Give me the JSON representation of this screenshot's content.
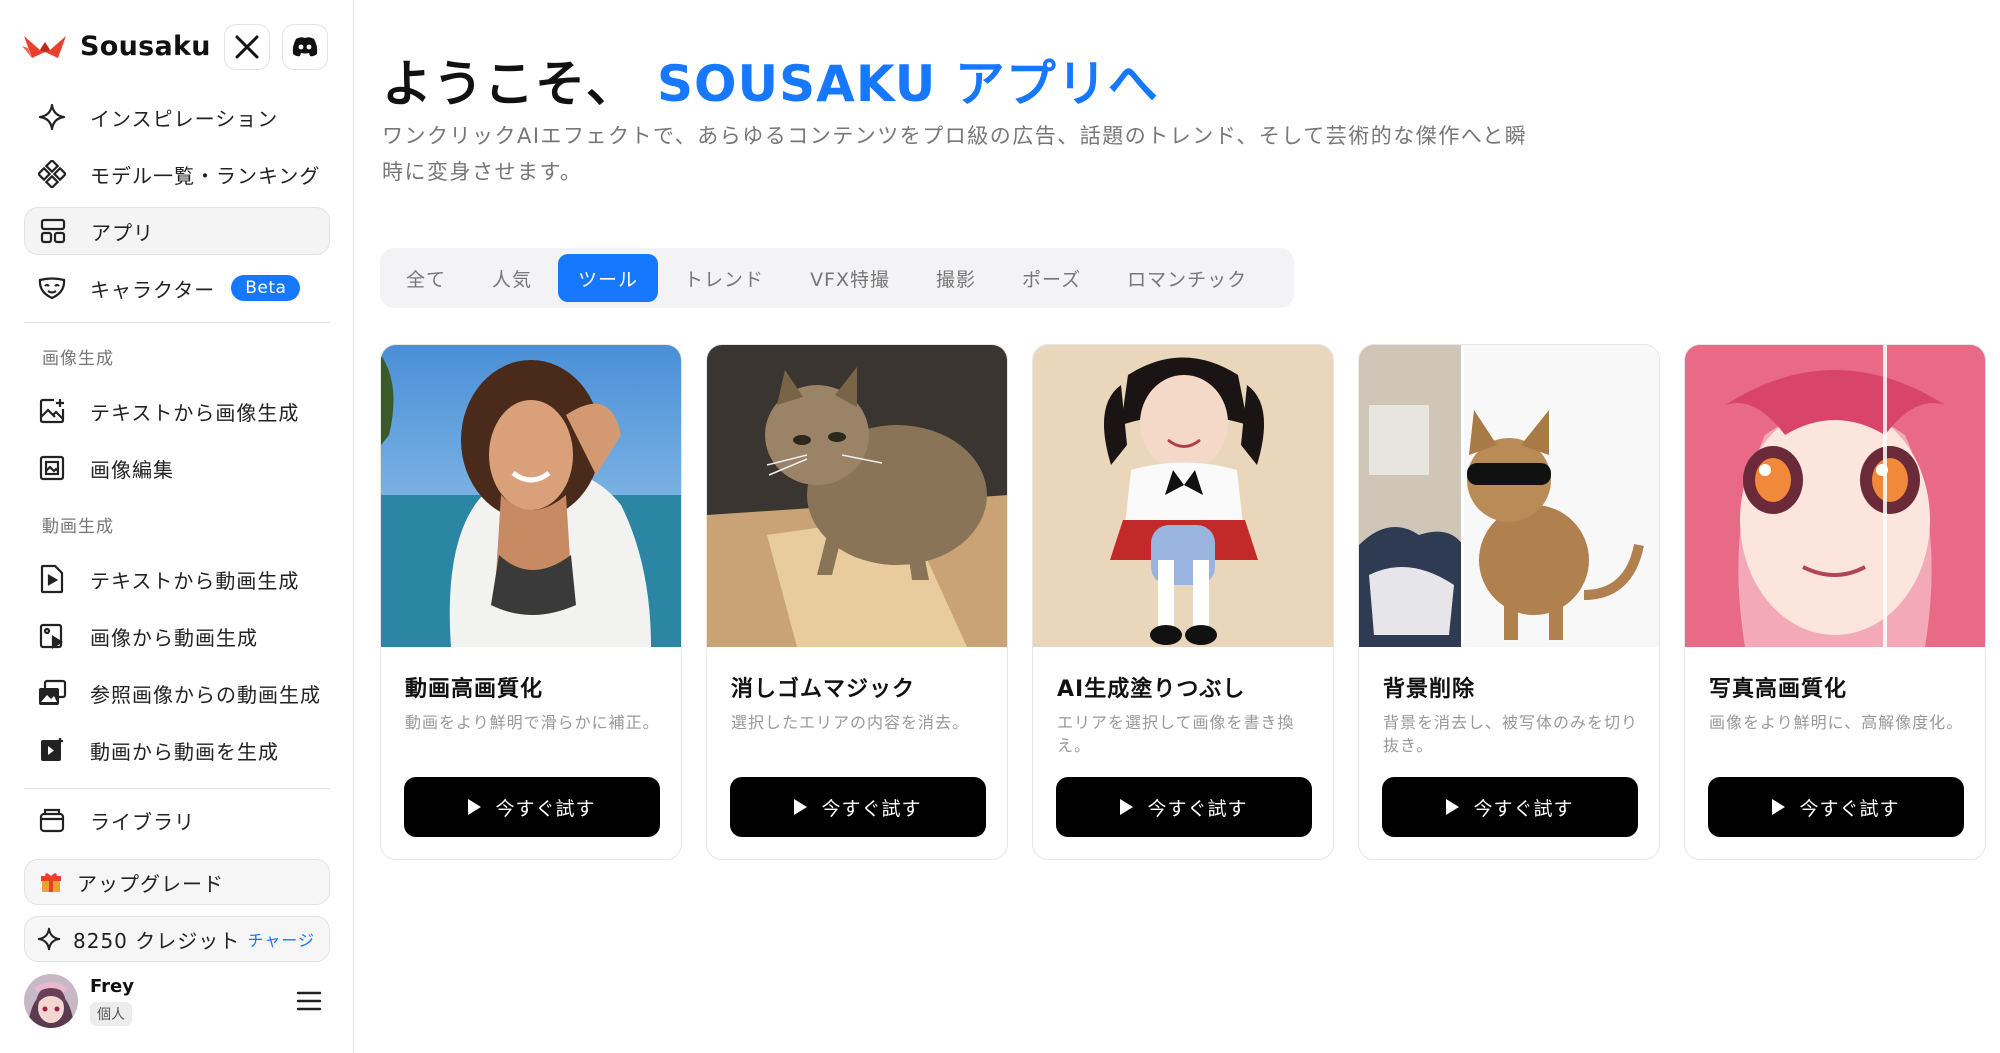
{
  "sidebar": {
    "brand": {
      "name": "Sousaku",
      "logo_icon": "origami-crane-icon",
      "accent": "#e8402c"
    },
    "social": [
      {
        "icon": "x-logo-icon"
      },
      {
        "icon": "discord-icon"
      }
    ],
    "nav_top": [
      {
        "label": "インスピレーション",
        "icon": "sparkle-icon"
      },
      {
        "label": "モデル一覧・ランキング",
        "icon": "diamond-grid-icon"
      },
      {
        "label": "アプリ",
        "icon": "app-layout-icon",
        "active": true
      },
      {
        "label": "キャラクター",
        "icon": "mask-icon",
        "badge": "Beta"
      }
    ],
    "section_image": "画像生成",
    "nav_image": [
      {
        "label": "テキストから画像生成",
        "icon": "image-add-icon"
      },
      {
        "label": "画像編集",
        "icon": "image-edit-icon"
      }
    ],
    "section_video": "動画生成",
    "nav_video": [
      {
        "label": "テキストから動画生成",
        "icon": "video-file-icon"
      },
      {
        "label": "画像から動画生成",
        "icon": "image-to-video-icon"
      },
      {
        "label": "参照画像からの動画生成",
        "icon": "reference-images-icon"
      },
      {
        "label": "動画から動画を生成",
        "icon": "video-to-video-icon"
      }
    ],
    "library": {
      "label": "ライブラリ",
      "icon": "library-icon"
    },
    "upgrade": {
      "label": "アップグレード",
      "icon": "gift-icon"
    },
    "credits": {
      "label": "8250 クレジット",
      "icon": "sparkle-icon",
      "charge": "チャージ"
    },
    "user": {
      "name": "Frey",
      "plan": "個人",
      "menu_icon": "hamburger-icon"
    }
  },
  "main": {
    "title_prefix": "ようこそ、",
    "title_accent": "SOUSAKU アプリへ",
    "accent_color": "#1677ff",
    "description": "ワンクリックAIエフェクトで、あらゆるコンテンツをプロ級の広告、話題のトレンド、そして芸術的な傑作へと瞬時に変身させます。",
    "tabs": [
      "全て",
      "人気",
      "ツール",
      "トレンド",
      "VFX特撮",
      "撮影",
      "ポーズ",
      "ロマンチック"
    ],
    "active_tab": "ツール",
    "cards": [
      {
        "title": "動画高画質化",
        "desc": "動画をより鮮明で滑らかに補正。",
        "button": "今すぐ試す"
      },
      {
        "title": "消しゴムマジック",
        "desc": "選択したエリアの内容を消去。",
        "button": "今すぐ試す"
      },
      {
        "title": "AI生成塗りつぶし",
        "desc": "エリアを選択して画像を書き換え。",
        "button": "今すぐ試す"
      },
      {
        "title": "背景削除",
        "desc": "背景を消去し、被写体のみを切り抜き。",
        "button": "今すぐ試す"
      },
      {
        "title": "写真高画質化",
        "desc": "画像をより鮮明に、高解像度化。",
        "button": "今すぐ試す"
      }
    ]
  }
}
